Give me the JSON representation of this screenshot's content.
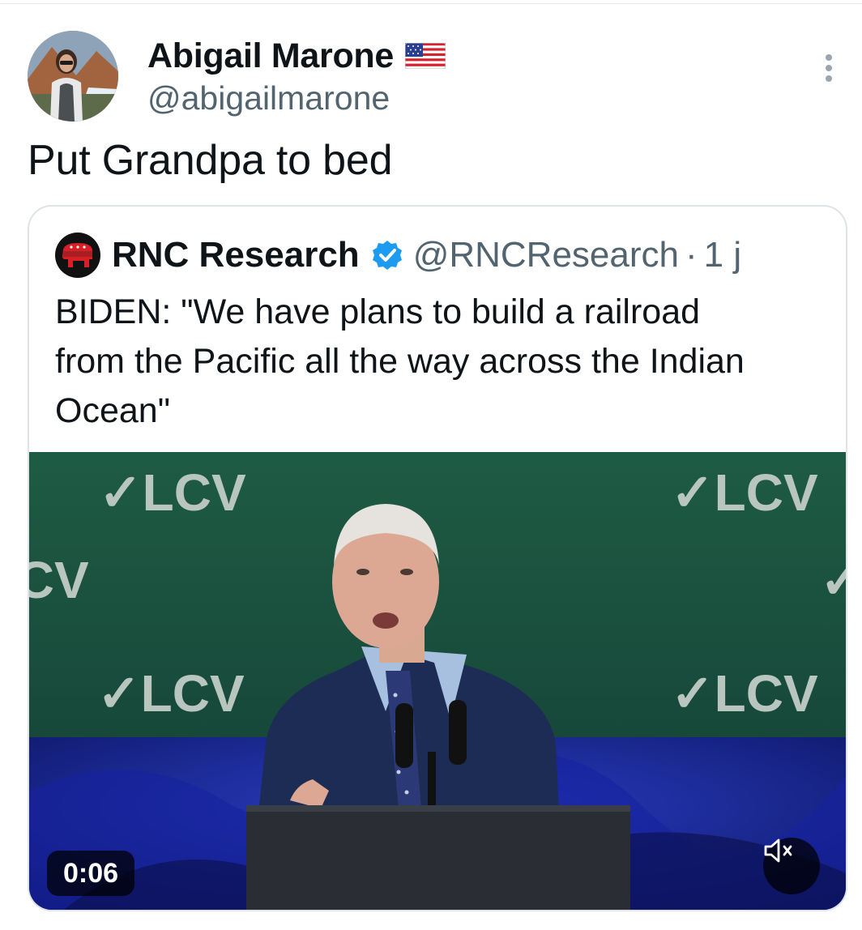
{
  "author": {
    "display_name": "Abigail Marone",
    "handle": "@abigailmarone",
    "name_emoji": "us-flag-icon"
  },
  "tweet": {
    "text": "Put Grandpa to bed"
  },
  "quoted": {
    "display_name": "RNC Research",
    "handle": "@RNCResearch",
    "separator": "·",
    "time": "1 j",
    "text_lines": [
      "BIDEN: \"We have plans to build a railroad",
      "from the Pacific all the way across the Indian",
      "Ocean\""
    ],
    "video": {
      "timestamp": "0:06",
      "backdrop_text": "✓LCV",
      "muted": true
    }
  },
  "icons": [
    "more-options-icon",
    "verified-badge-icon",
    "rnc-elephant-logo",
    "volume-muted-icon"
  ],
  "colors": {
    "text_primary": "#0f1419",
    "text_secondary": "#536471",
    "verified_blue": "#1d9bf0",
    "backdrop_green": "#1f5540",
    "stage_blue": "#1a2a8a"
  }
}
